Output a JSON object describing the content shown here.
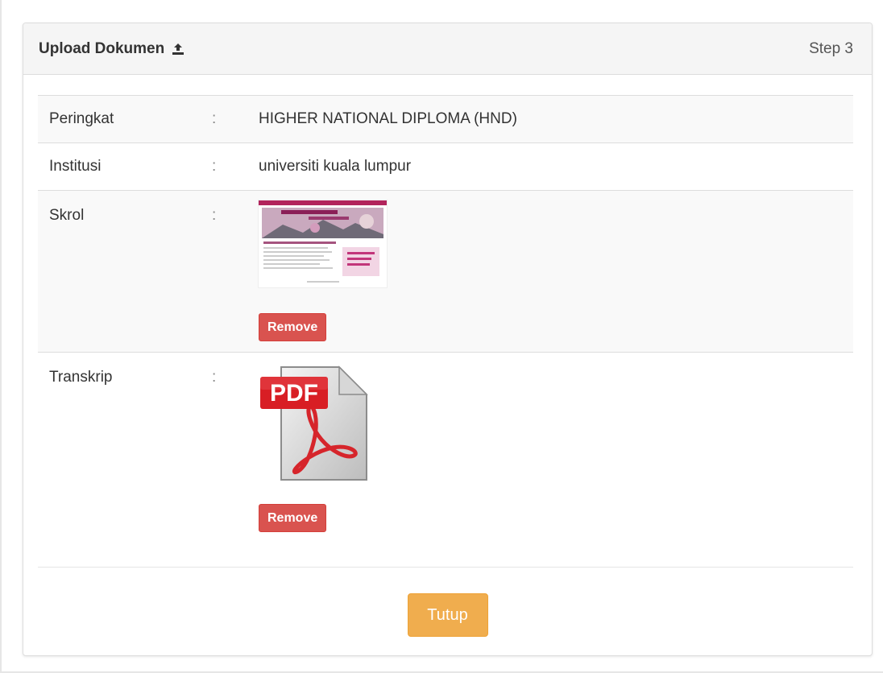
{
  "panel": {
    "title": "Upload Dokumen",
    "title_icon": "upload-icon",
    "step": "Step 3"
  },
  "rows": [
    {
      "label": "Peringkat",
      "separator": ":",
      "value": "HIGHER NATIONAL DIPLOMA (HND)"
    },
    {
      "label": "Institusi",
      "separator": ":",
      "value": "universiti kuala lumpur"
    },
    {
      "label": "Skrol",
      "separator": ":",
      "remove_label": "Remove",
      "preview": "image-thumbnail"
    },
    {
      "label": "Transkrip",
      "separator": ":",
      "remove_label": "Remove",
      "preview": "pdf-icon",
      "pdf_text": "PDF"
    }
  ],
  "footer": {
    "close_label": "Tutup"
  },
  "colors": {
    "danger": "#d9534f",
    "warning": "#f0ad4e",
    "heading_bg": "#f5f5f5",
    "stripe_bg": "#f9f9f9"
  }
}
